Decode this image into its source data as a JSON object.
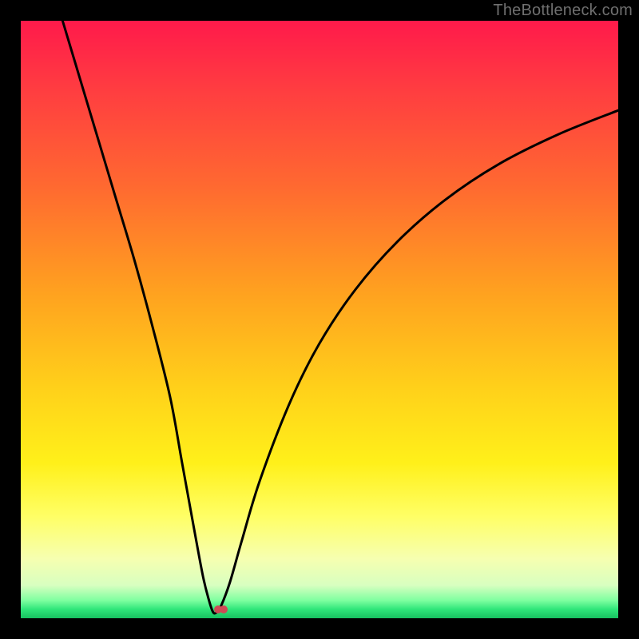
{
  "watermark": "TheBottleneck.com",
  "chart_data": {
    "type": "line",
    "title": "",
    "xlabel": "",
    "ylabel": "",
    "xlim": [
      0,
      100
    ],
    "ylim": [
      0,
      100
    ],
    "grid": false,
    "legend": false,
    "background_gradient_stops": [
      {
        "offset": 0.0,
        "color": "#ff1a4b"
      },
      {
        "offset": 0.12,
        "color": "#ff3e40"
      },
      {
        "offset": 0.28,
        "color": "#ff6a30"
      },
      {
        "offset": 0.46,
        "color": "#ffa31f"
      },
      {
        "offset": 0.62,
        "color": "#ffd21a"
      },
      {
        "offset": 0.74,
        "color": "#fff01a"
      },
      {
        "offset": 0.83,
        "color": "#ffff66"
      },
      {
        "offset": 0.9,
        "color": "#f6ffb0"
      },
      {
        "offset": 0.945,
        "color": "#d8ffc0"
      },
      {
        "offset": 0.97,
        "color": "#7fffa0"
      },
      {
        "offset": 0.985,
        "color": "#2fe67a"
      },
      {
        "offset": 1.0,
        "color": "#18c060"
      }
    ],
    "series": [
      {
        "name": "bottleneck-curve",
        "color": "#000000",
        "stroke_width": 3,
        "x": [
          7,
          10,
          13,
          16,
          19,
          22,
          25,
          27,
          29,
          30.5,
          31.5,
          32.2,
          32.8,
          33.5,
          35,
          37,
          40,
          45,
          50,
          56,
          63,
          71,
          80,
          90,
          100
        ],
        "y": [
          100,
          90,
          80,
          70,
          60,
          49,
          37,
          26,
          15,
          7,
          3,
          1,
          1,
          2,
          6,
          13,
          23,
          36,
          46,
          55,
          63,
          70,
          76,
          81,
          85
        ]
      }
    ],
    "marker": {
      "name": "optimal-point",
      "x": 33.5,
      "y": 1.5,
      "color": "#cf4a55",
      "dots": 2
    }
  }
}
